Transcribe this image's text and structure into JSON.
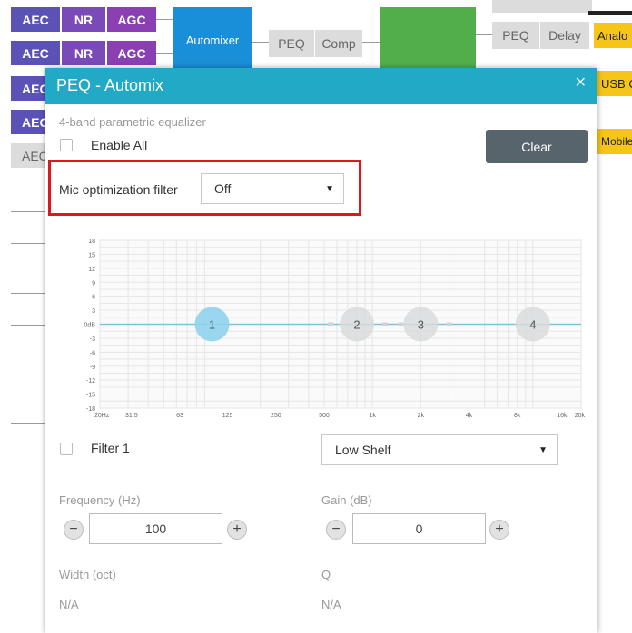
{
  "canvas": {
    "aec_rows": [
      {
        "aec": "AEC",
        "nr": "NR",
        "agc": "AGC"
      },
      {
        "aec": "AEC",
        "nr": "NR",
        "agc": "AGC"
      }
    ],
    "partial_aec_labels": [
      "AEC",
      "AEC",
      "AEC"
    ],
    "automixer_label": "Automixer",
    "mid_chain": {
      "peq": "PEQ",
      "comp": "Comp"
    },
    "right_chain": {
      "peq": "PEQ",
      "delay": "Delay"
    },
    "outputs": [
      "Analo",
      "USB O",
      "Mobile"
    ]
  },
  "modal": {
    "title": "PEQ - Automix",
    "close_icon": "close-icon",
    "subtitle": "4-band parametric equalizer",
    "enable_all_label": "Enable All",
    "clear_label": "Clear",
    "mic_filter": {
      "label": "Mic optimization filter",
      "value": "Off"
    },
    "accent_color": "#21a9c6",
    "highlight_color": "#e0161f"
  },
  "eq_graph": {
    "y_ticks": [
      "18",
      "15",
      "12",
      "9",
      "6",
      "3",
      "0dB",
      "-3",
      "-6",
      "-9",
      "-12",
      "-15",
      "-18"
    ],
    "x_ticks": [
      "20Hz",
      "31.5",
      "63",
      "125",
      "250",
      "500",
      "1k",
      "2k",
      "4k",
      "8k",
      "16k",
      "20k"
    ],
    "bands": [
      {
        "label": "1",
        "freq_hz": 100,
        "gain_db": 0,
        "active": true
      },
      {
        "label": "2",
        "freq_hz": 800,
        "gain_db": 0,
        "active": false
      },
      {
        "label": "3",
        "freq_hz": 2000,
        "gain_db": 0,
        "active": false
      },
      {
        "label": "4",
        "freq_hz": 10000,
        "gain_db": 0,
        "active": false
      }
    ]
  },
  "filter": {
    "label": "Filter 1",
    "type": "Low Shelf",
    "frequency": {
      "label": "Frequency (Hz)",
      "value": "100"
    },
    "gain": {
      "label": "Gain (dB)",
      "value": "0"
    },
    "width": {
      "label": "Width (oct)",
      "value": "N/A"
    },
    "q": {
      "label": "Q",
      "value": "N/A"
    }
  }
}
